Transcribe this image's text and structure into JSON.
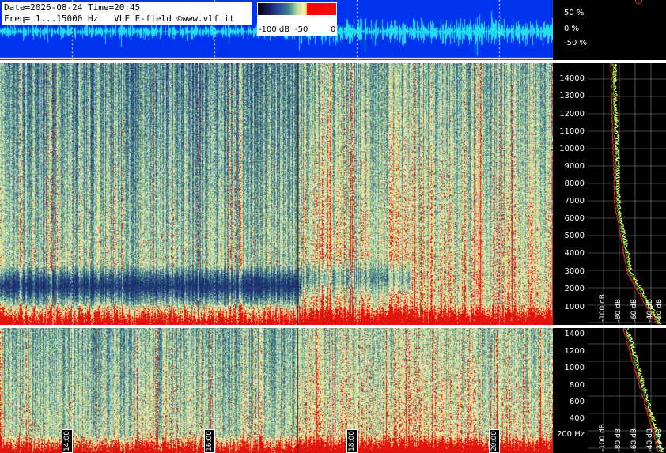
{
  "header": {
    "line1": "Date=2026-08-24 Time=20:45",
    "line2": "Freq= 1...15000 Hz   VLF E-field ©www.vlf.it"
  },
  "colorbar": {
    "labels": [
      "-100 dB",
      "-50",
      "0"
    ]
  },
  "amplitude_scale": [
    "50 %",
    "0 %",
    "-50 %"
  ],
  "main_freq_ticks": [
    "14000",
    "13000",
    "12000",
    "11000",
    "10000",
    "9000",
    "8000",
    "7000",
    "6000",
    "5000",
    "4000",
    "3000",
    "2000",
    "1000"
  ],
  "low_freq_ticks": [
    "1400",
    "1200",
    "1000",
    "800",
    "600",
    "400",
    "200 Hz"
  ],
  "time_labels": [
    "14:00",
    "16:00",
    "18:00",
    "20:00"
  ],
  "main_db_labels": [
    "-100 dB",
    "-80 dB",
    "-60 dB",
    "-40 dB",
    "-20 dB"
  ],
  "low_db_labels": [
    "-100 dB",
    "-80 dB",
    "-60 dB",
    "-40 dB",
    "-20 dB"
  ],
  "colors": {
    "waveform_bg": "#0033ee",
    "trace": "#22ddee",
    "hot": "#ee1111"
  }
}
